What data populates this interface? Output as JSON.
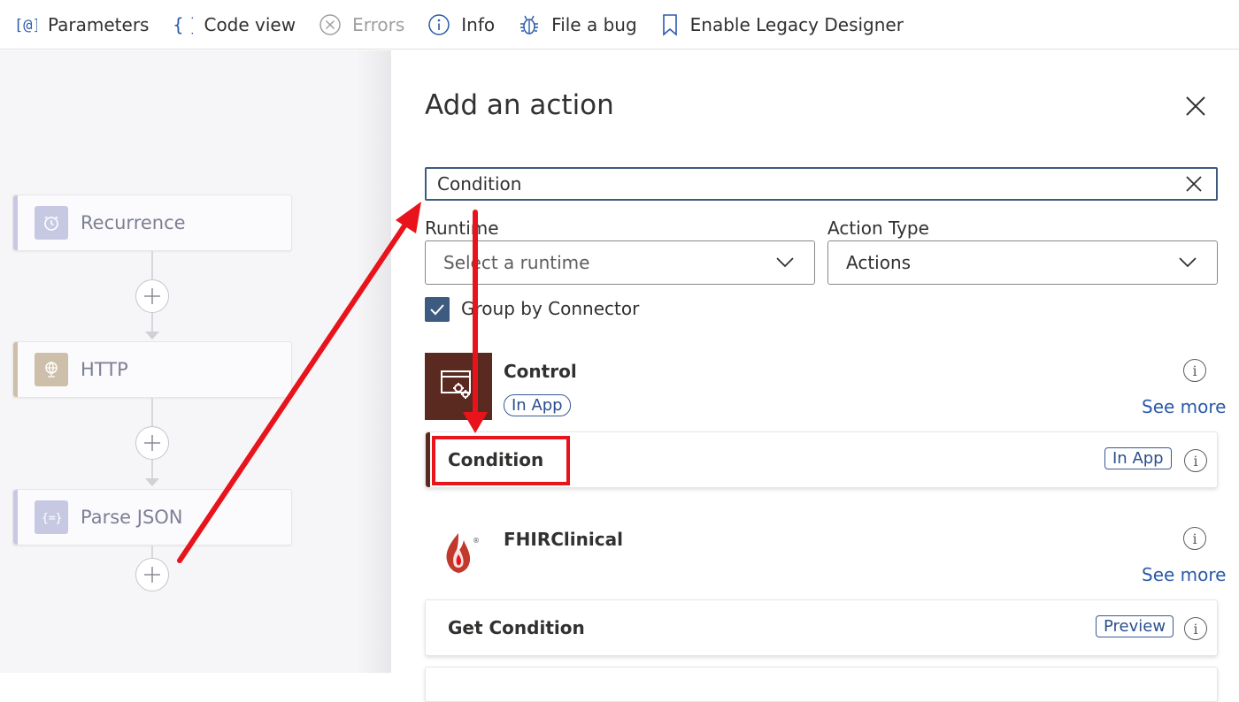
{
  "toolbar": {
    "items": [
      {
        "label": "Parameters",
        "icon": "parameters-icon",
        "disabled": false
      },
      {
        "label": "Code view",
        "icon": "code-view-icon",
        "disabled": false
      },
      {
        "label": "Errors",
        "icon": "errors-icon",
        "disabled": true
      },
      {
        "label": "Info",
        "icon": "info-icon",
        "disabled": false
      },
      {
        "label": "File a bug",
        "icon": "bug-icon",
        "disabled": false
      },
      {
        "label": "Enable Legacy Designer",
        "icon": "bookmark-icon",
        "disabled": false
      }
    ]
  },
  "canvas": {
    "nodes": [
      {
        "label": "Recurrence",
        "icon": "clock-icon",
        "accent": "#c7c9e3"
      },
      {
        "label": "HTTP",
        "icon": "globe-icon",
        "accent": "#cdbfa9"
      },
      {
        "label": "Parse JSON",
        "icon": "json-icon",
        "accent": "#c7c9e3"
      }
    ]
  },
  "panel": {
    "title": "Add an action",
    "search_value": "Condition",
    "runtime_label": "Runtime",
    "runtime_placeholder": "Select a runtime",
    "action_type_label": "Action Type",
    "action_type_value": "Actions",
    "group_by_label": "Group by Connector",
    "group_by_checked": true,
    "connectors": [
      {
        "name": "Control",
        "badge": "In App",
        "see_more": "See more",
        "icon": "control-gear-icon",
        "icon_bg": "#5a2a21",
        "actions": [
          {
            "name": "Condition",
            "badge": "In App"
          }
        ]
      },
      {
        "name": "FHIRClinical",
        "badge": "",
        "see_more": "See more",
        "icon": "fhir-flame-icon",
        "actions": [
          {
            "name": "Get Condition",
            "badge": "Preview"
          }
        ]
      }
    ]
  },
  "colors": {
    "accent": "#3d5a80",
    "link": "#2b5aa8",
    "annotation": "#e8131b",
    "control_brown": "#5a2a21"
  }
}
